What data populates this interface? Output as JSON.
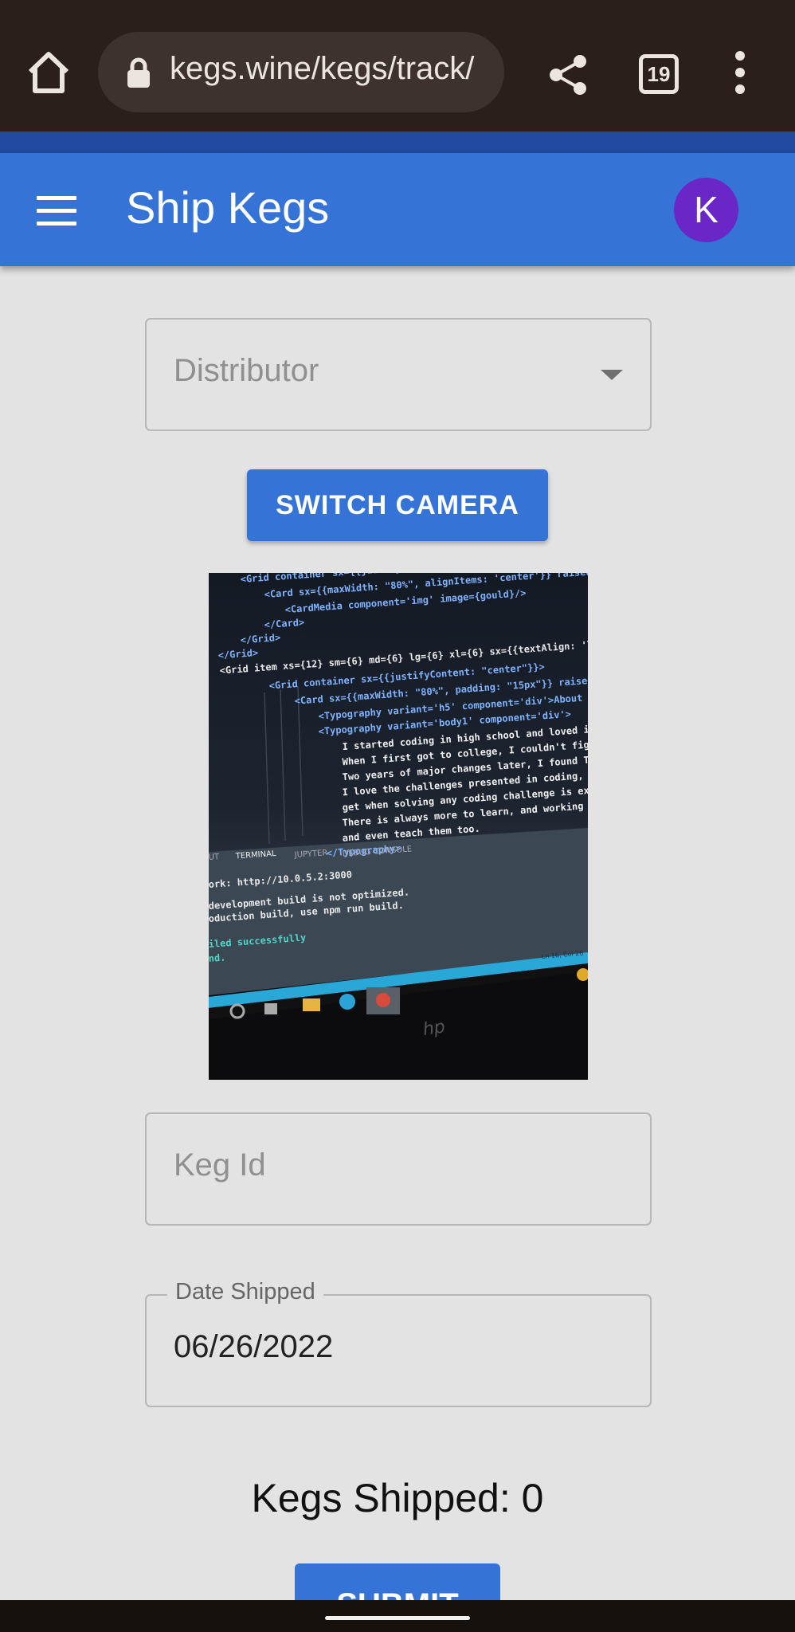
{
  "browser": {
    "url": "kegs.wine/kegs/track/",
    "tab_count": "19"
  },
  "app_bar": {
    "title": "Ship Kegs",
    "avatar_letter": "K",
    "avatar_color": "#6a26c7",
    "bar_color": "#3574d6"
  },
  "form": {
    "distributor_placeholder": "Distributor",
    "switch_camera_label": "SWITCH CAMERA",
    "keg_id_placeholder": "Keg Id",
    "date_label": "Date Shipped",
    "date_value": "06/26/2022",
    "kegs_shipped_text": "Kegs Shipped: 0",
    "submit_label": "SUBMIT"
  },
  "camera_feed": {
    "code_lines": [
      "<Grid container sx={{justifyContent: 'center'}} raised",
      "<Card sx={{maxWidth: \"80%\", alignItems: 'center'}} raised",
      "<CardMedia component='img' image={gould}/>",
      "</Card>",
      "</Grid>",
      "</Grid>",
      "<Grid item xs={12} sm={6} md={6} lg={6} xl={6} sx={{textAlign: 'l",
      "<Grid container sx={{justifyContent: \"center\"}}>",
      "<Card sx={{maxWidth: \"80%\", padding: \"15px\"}} raised",
      "<Typography variant='h5' component='div'>About me",
      "<Typography variant='body1' component='div'>",
      "I started coding in high school and loved it",
      "When I first got to college, I couldn't figu",
      "Two years of major changes later, I found Th",
      "I love the challenges presented in coding, a",
      "get when solving any coding challenge is exc",
      "There is always more to learn, and working w",
      "and even teach them too.",
      "</Typography>"
    ],
    "terminal_tabs": [
      "UT",
      "TERMINAL",
      "JUPYTER",
      "DEBUG CONSOLE"
    ],
    "terminal_lines": [
      "ork:  http://10.0.5.2:3000",
      "development build is not optimized.",
      "oduction build, use npm run build.",
      "iled successfully",
      "nd."
    ],
    "status_text": "Ln 16, Col 26",
    "laptop_logo": "hp"
  }
}
